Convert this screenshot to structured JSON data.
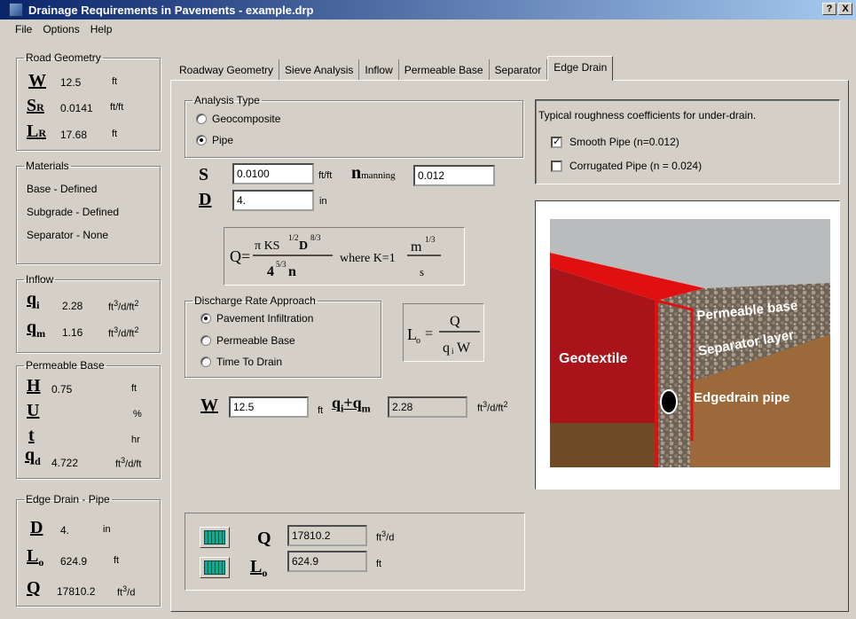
{
  "window": {
    "title": "Drainage Requirements in Pavements - example.drp",
    "help_btn": "?",
    "close_btn": "X"
  },
  "menu": [
    "File",
    "Options",
    "Help"
  ],
  "road_geometry": {
    "legend": "Road Geometry",
    "rows": [
      {
        "sym": "W",
        "sub": "",
        "value": "12.5",
        "unit": "ft"
      },
      {
        "sym": "S",
        "sub": "R",
        "value": "0.0141",
        "unit": "ft/ft"
      },
      {
        "sym": "L",
        "sub": "R",
        "value": "17.68",
        "unit": "ft"
      }
    ]
  },
  "materials": {
    "legend": "Materials",
    "items": [
      "Base - Defined",
      "Subgrade - Defined",
      "Separator - None"
    ]
  },
  "inflow": {
    "legend": "Inflow",
    "qi": {
      "value": "2.28",
      "unit": "ft3/d/ft2"
    },
    "qm": {
      "value": "1.16",
      "unit": "ft3/d/ft2"
    }
  },
  "permeable_base": {
    "legend": "Permeable Base",
    "H": {
      "value": "0.75",
      "unit": "ft"
    },
    "U": {
      "value": "",
      "unit": "%"
    },
    "t": {
      "value": "",
      "unit": "hr"
    },
    "qd": {
      "value": "4.722",
      "unit": "ft3/d/ft"
    }
  },
  "edge_drain_summary": {
    "legend": "Edge Drain - Pipe",
    "D": {
      "value": "4.",
      "unit": "in"
    },
    "Lo": {
      "value": "624.9",
      "unit": "ft"
    },
    "Q": {
      "value": "17810.2",
      "unit": "ft3/d"
    }
  },
  "tabs": [
    "Roadway Geometry",
    "Sieve Analysis",
    "Inflow",
    "Permeable Base",
    "Separator",
    "Edge Drain"
  ],
  "active_tab": "Edge Drain",
  "analysis_type": {
    "legend": "Analysis Type",
    "options": [
      "Geocomposite",
      "Pipe"
    ],
    "selected": "Pipe"
  },
  "inputs": {
    "S": {
      "value": "0.0100",
      "unit": "ft/ft"
    },
    "n_manning": {
      "label": "manning",
      "value": "0.012"
    },
    "D": {
      "value": "4.",
      "unit": "in"
    },
    "W": {
      "value": "12.5",
      "unit": "ft"
    },
    "qiqm": {
      "value": "2.28",
      "unit": "ft3/d/ft2"
    }
  },
  "discharge": {
    "legend": "Discharge Rate Approach",
    "options": [
      "Pavement Infiltration",
      "Permeable Base",
      "Time To Drain"
    ],
    "selected": "Pavement Infiltration"
  },
  "roughness": {
    "title": "Typical roughness coefficients for under-drain.",
    "options": [
      {
        "label": "Smooth Pipe (n=0.012)",
        "checked": true
      },
      {
        "label": "Corrugated Pipe (n = 0.024)",
        "checked": false
      }
    ]
  },
  "diagram_labels": {
    "permeable_base": "Permeable base",
    "separator": "Separator layer",
    "geotextile": "Geotextile",
    "edgedrain": "Edgedrain pipe"
  },
  "results": {
    "Q": {
      "value": "17810.2",
      "unit": "ft3/d"
    },
    "Lo": {
      "value": "624.9",
      "unit": "ft"
    }
  }
}
